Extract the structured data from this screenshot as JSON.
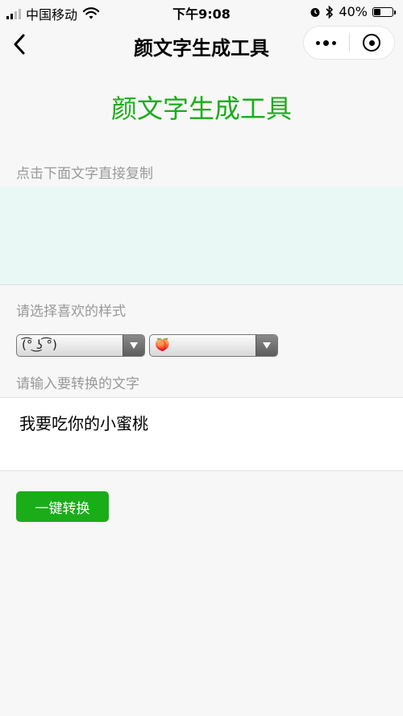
{
  "status_bar": {
    "carrier": "中国移动",
    "time": "下午9:08",
    "battery_percent": "40%",
    "battery_level": 0.4
  },
  "nav": {
    "title": "颜文字生成工具",
    "back_icon": "chevron-left-icon",
    "more_icon": "more-dots-icon",
    "close_icon": "target-circle-icon"
  },
  "page": {
    "heading": "颜文字生成工具",
    "copy_label": "点击下面文字直接复制",
    "output_text": "",
    "style_label": "请选择喜欢的样式",
    "face_select_value": "(͡° ͜ʖ ͡°)",
    "emoji_select_value": "🍑",
    "input_label": "请输入要转换的文字",
    "input_value": "我要吃你的小蜜桃",
    "convert_button": "一键转换"
  },
  "colors": {
    "accent": "#1aad19",
    "output_bg": "#e9f8f5",
    "page_bg": "#f7f7f7",
    "label": "#999999"
  }
}
